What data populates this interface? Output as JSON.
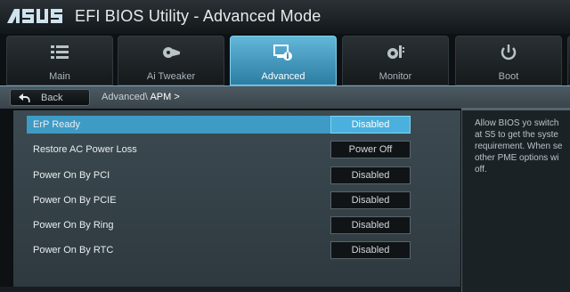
{
  "header": {
    "brand": "ASUS",
    "title": "EFI BIOS Utility - Advanced Mode"
  },
  "tabs": [
    {
      "label": "Main",
      "icon": "list-icon",
      "active": false
    },
    {
      "label": "Ai  Tweaker",
      "icon": "fan-icon",
      "active": false
    },
    {
      "label": "Advanced",
      "icon": "advanced-info-icon",
      "active": true
    },
    {
      "label": "Monitor",
      "icon": "monitor-gear-icon",
      "active": false
    },
    {
      "label": "Boot",
      "icon": "power-icon",
      "active": false
    }
  ],
  "nav": {
    "back_label": "Back",
    "breadcrumb_path": "Advanced\\",
    "breadcrumb_current": "APM >"
  },
  "settings": [
    {
      "label": "ErP Ready",
      "value": "Disabled",
      "selected": true
    },
    {
      "label": "Restore AC Power Loss",
      "value": "Power Off",
      "selected": false
    },
    {
      "label": "Power On By PCI",
      "value": "Disabled",
      "selected": false
    },
    {
      "label": "Power On By PCIE",
      "value": "Disabled",
      "selected": false
    },
    {
      "label": "Power On By Ring",
      "value": "Disabled",
      "selected": false
    },
    {
      "label": "Power On By RTC",
      "value": "Disabled",
      "selected": false
    }
  ],
  "help": {
    "lines": [
      "Allow BIOS yo switch",
      "at S5 to get the syste",
      "requirement. When se",
      "other PME options wi",
      "off."
    ]
  },
  "colors": {
    "accent": "#3e9bc6",
    "active_tab": "#4aa6cf",
    "background": "#0d1114"
  }
}
